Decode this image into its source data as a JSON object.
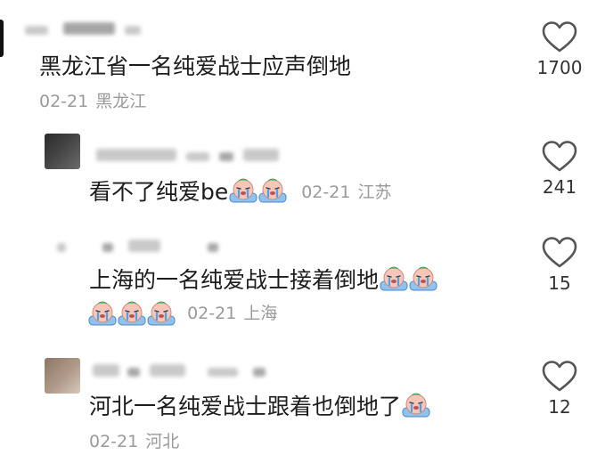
{
  "comments": [
    {
      "text": "黑龙江省一名纯爱战士应声倒地",
      "date": "02-21",
      "location": "黑龙江",
      "likes": "1700",
      "emoji_count": 0
    },
    {
      "text": "看不了纯爱be",
      "date": "02-21",
      "location": "江苏",
      "likes": "241",
      "emoji_count": 2
    },
    {
      "text": "上海的一名纯爱战士接着倒地",
      "date": "02-21",
      "location": "上海",
      "likes": "15",
      "emoji_count": 5
    },
    {
      "text": "河北一名纯爱战士跟着也倒地了",
      "date": "02-21",
      "location": "河北",
      "likes": "12",
      "emoji_count": 1
    }
  ],
  "icons": {
    "like": "heart-outline-icon",
    "emoji": "crying-face-emoji-icon"
  },
  "colors": {
    "text": "#1c1c1c",
    "meta": "#9a9a9a",
    "icon": "#555555"
  }
}
